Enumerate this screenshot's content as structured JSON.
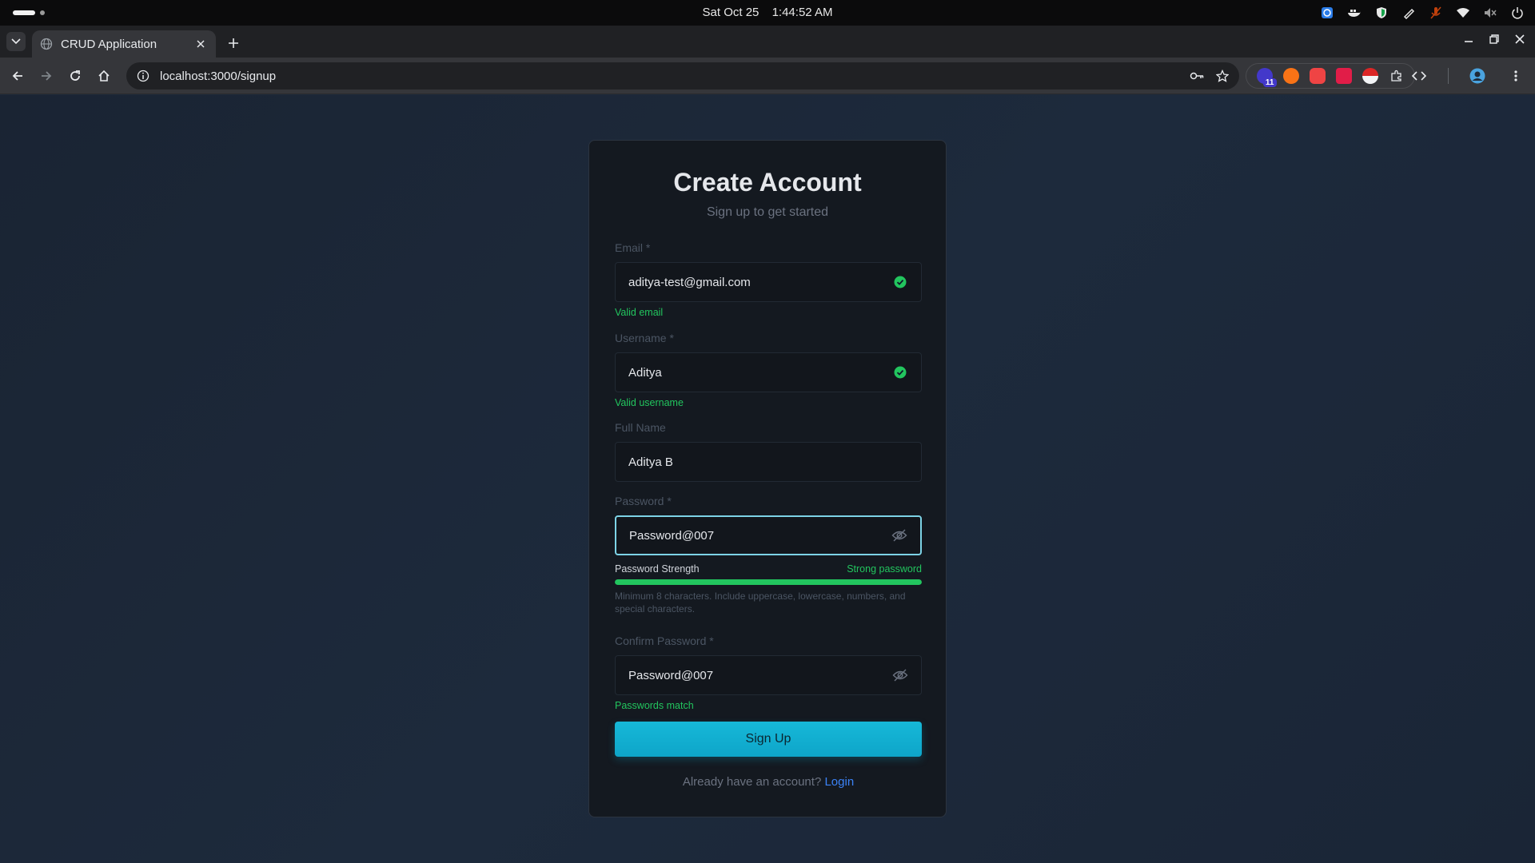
{
  "os": {
    "date": "Sat Oct 25",
    "time": "1:44:52 AM"
  },
  "browser": {
    "tab_title": "CRUD Application",
    "url": "localhost:3000/signup",
    "extension_badge": "11"
  },
  "form": {
    "title": "Create Account",
    "subtitle": "Sign up to get started",
    "email": {
      "label": "Email *",
      "value": "aditya-test@gmail.com",
      "hint": "Valid email"
    },
    "username": {
      "label": "Username *",
      "value": "Aditya",
      "hint": "Valid username"
    },
    "full_name": {
      "label": "Full Name",
      "value": "Aditya B"
    },
    "password": {
      "label": "Password *",
      "value": "Password@007",
      "strength_label": "Password Strength",
      "strength_text": "Strong password",
      "strength_fraction": 1.0,
      "rules": "Minimum 8 characters. Include uppercase, lowercase, numbers, and special characters."
    },
    "confirm_password": {
      "label": "Confirm Password *",
      "value": "Password@007",
      "hint": "Passwords match"
    },
    "submit_label": "Sign Up",
    "login_prompt": "Already have an account?",
    "login_link": "Login"
  },
  "colors": {
    "accent": "#0ea5c9",
    "success": "#22c55e",
    "link": "#3b82f6"
  }
}
